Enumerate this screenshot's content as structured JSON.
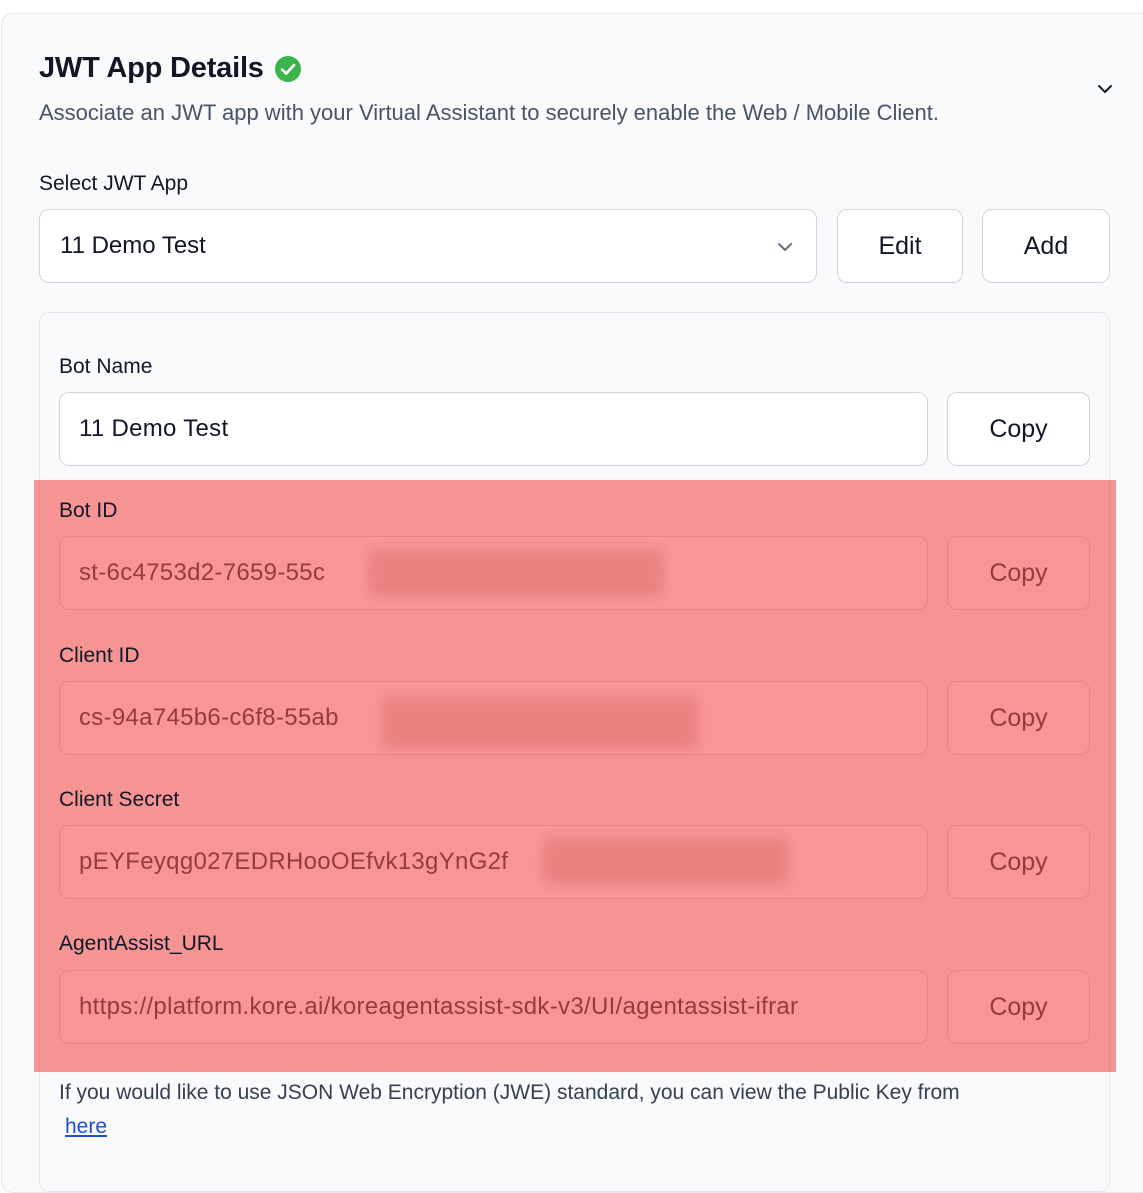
{
  "section": {
    "title": "JWT App Details",
    "subtitle": "Associate an JWT app with your Virtual Assistant to securely enable the Web / Mobile Client."
  },
  "select_app": {
    "label": "Select JWT App",
    "value": "11 Demo Test",
    "edit_label": "Edit",
    "add_label": "Add"
  },
  "fields": [
    {
      "label": "Bot Name",
      "value": "11 Demo Test",
      "copy_label": "Copy"
    },
    {
      "label": "Bot ID",
      "value": "st-6c4753d2-7659-55c",
      "copy_label": "Copy"
    },
    {
      "label": "Client ID",
      "value": "cs-94a745b6-c6f8-55ab",
      "copy_label": "Copy"
    },
    {
      "label": "Client Secret",
      "value": "pEYFeyqg027EDRHooOEfvk13gYnG2f",
      "copy_label": "Copy"
    },
    {
      "label": "AgentAssist_URL",
      "value": "https://platform.kore.ai/koreagentassist-sdk-v3/UI/agentassist-ifrar",
      "copy_label": "Copy"
    }
  ],
  "note": {
    "text": "If you would like to use JSON Web Encryption (JWE) standard, you can view the Public Key from",
    "link_label": "here"
  },
  "colors": {
    "success": "#3bb54a",
    "highlight": "#f45050",
    "link": "#1d4ed8"
  },
  "icons": {
    "status": "check-circle-icon",
    "collapse": "chevron-down-icon",
    "select": "chevron-down-icon"
  }
}
